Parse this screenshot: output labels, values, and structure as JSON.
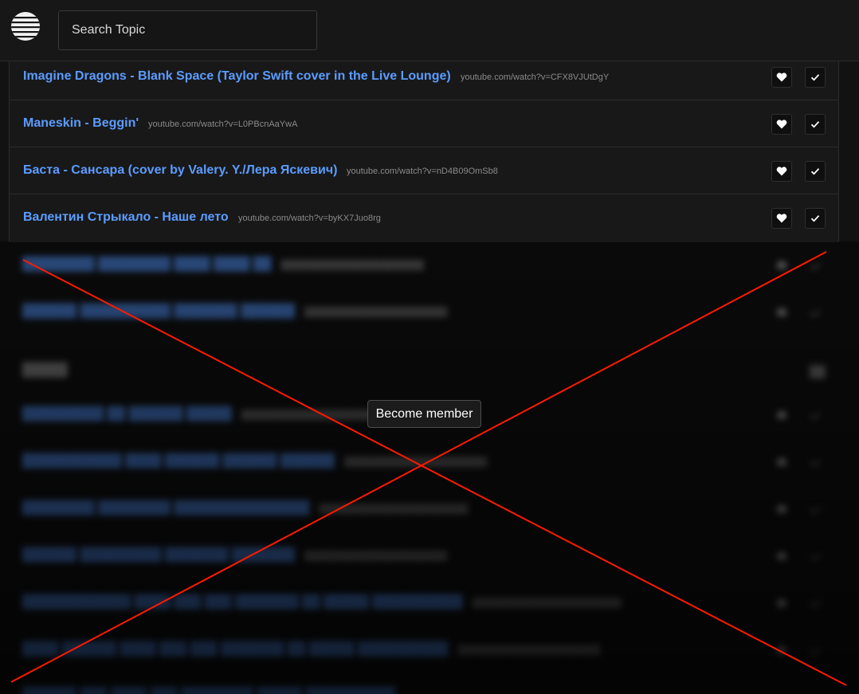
{
  "header": {
    "logo_icon": "globe-logo-icon",
    "search_placeholder": "Search Topic"
  },
  "songs": [
    {
      "title": "Imagine Dragons - Blank Space (Taylor Swift cover in the Live Lounge)",
      "url": "youtube.com/watch?v=CFX8VJUtDgY"
    },
    {
      "title": "Maneskin - Beggin'",
      "url": "youtube.com/watch?v=L0PBcnAaYwA"
    },
    {
      "title": "Баста - Сансара (cover by Valery. Y./Лера Яскевич)",
      "url": "youtube.com/watch?v=nD4B09OmSb8"
    },
    {
      "title": "Валентин Стрыкало - Наше лето",
      "url": "youtube.com/watch?v=byKX7Juo8rg"
    }
  ],
  "actions": {
    "favorite_icon": "heart-icon",
    "done_icon": "checkmark-icon"
  },
  "overlay": {
    "member_button_label": "Become member"
  },
  "colors": {
    "background": "#121212",
    "link_blue": "#5b9cff",
    "cross_red": "#ff1a00"
  }
}
